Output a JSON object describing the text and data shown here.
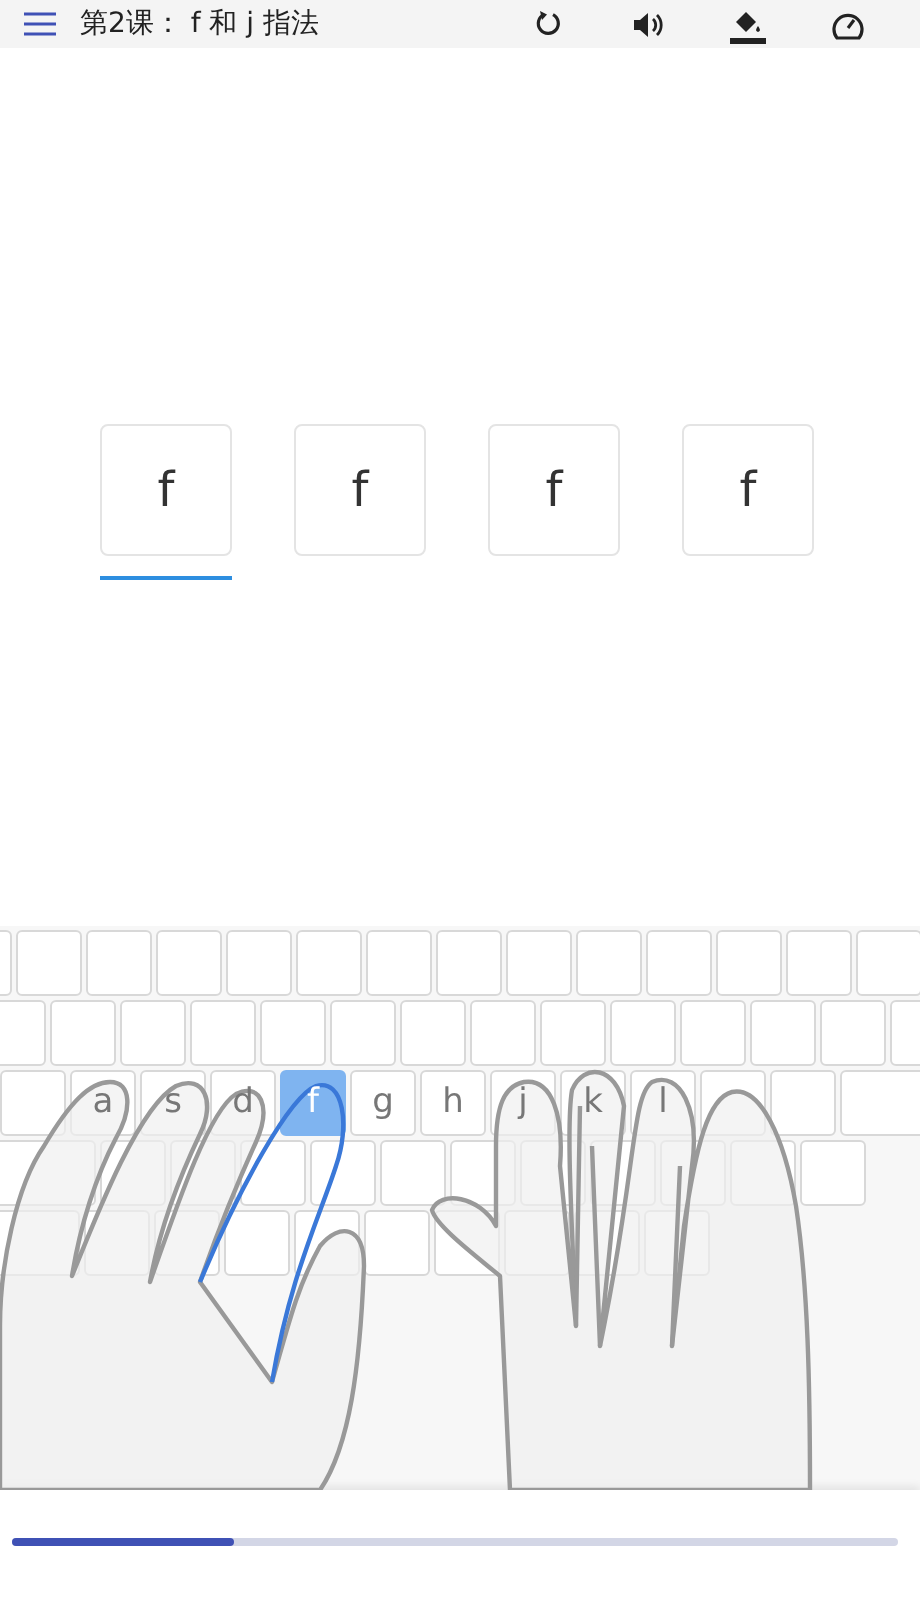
{
  "app_bar": {
    "title": "第2课： f 和 j 指法"
  },
  "cards": [
    {
      "char": "f",
      "selected": true
    },
    {
      "char": "f",
      "selected": false
    },
    {
      "char": "f",
      "selected": false
    },
    {
      "char": "f",
      "selected": false
    }
  ],
  "keyboard": {
    "home_row": [
      {
        "label": "a",
        "selected": false
      },
      {
        "label": "s",
        "selected": false
      },
      {
        "label": "d",
        "selected": false
      },
      {
        "label": "f",
        "selected": true
      },
      {
        "label": "g",
        "selected": false
      },
      {
        "label": "h",
        "selected": false
      },
      {
        "label": "j",
        "selected": false
      },
      {
        "label": "k",
        "selected": false
      },
      {
        "label": "l",
        "selected": false
      }
    ]
  },
  "progress": {
    "level": 0.25
  }
}
